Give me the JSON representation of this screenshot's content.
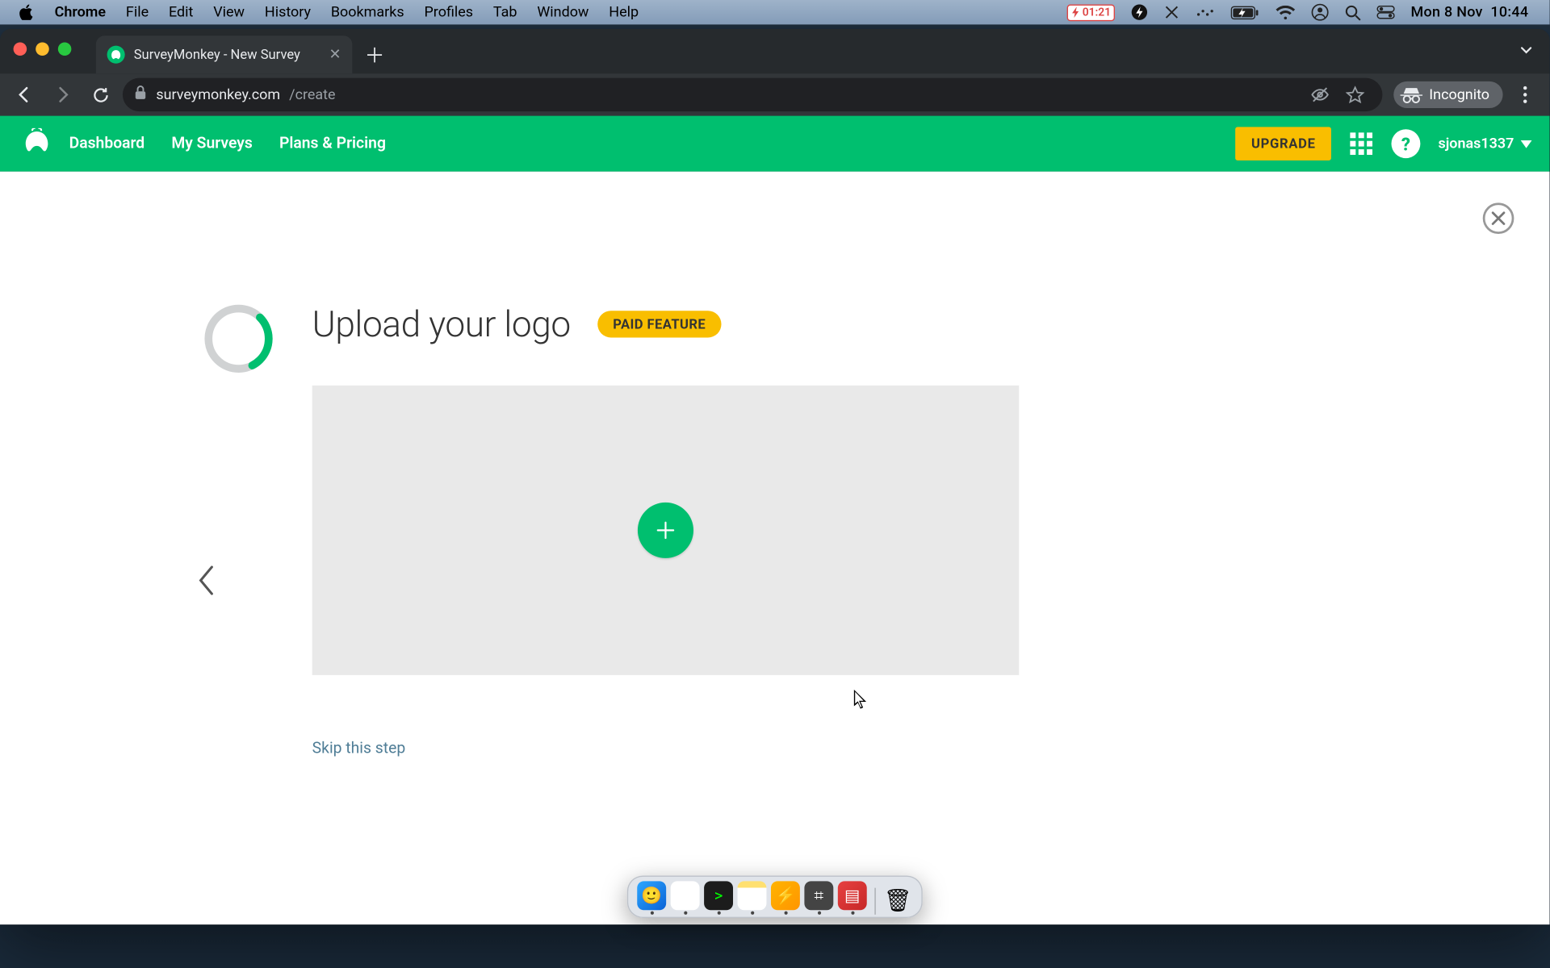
{
  "mac_menu": {
    "app": "Chrome",
    "items": [
      "File",
      "Edit",
      "View",
      "History",
      "Bookmarks",
      "Profiles",
      "Tab",
      "Window",
      "Help"
    ],
    "battery_timer": "01:21",
    "date": "Mon 8 Nov",
    "time": "10:44"
  },
  "browser": {
    "tab_title": "SurveyMonkey - New Survey",
    "url_host": "surveymonkey.com",
    "url_path": "/create",
    "incognito_label": "Incognito"
  },
  "sm_header": {
    "nav": [
      "Dashboard",
      "My Surveys",
      "Plans & Pricing"
    ],
    "upgrade": "UPGRADE",
    "username": "sjonas1337"
  },
  "wizard": {
    "title": "Upload your logo",
    "badge": "PAID FEATURE",
    "skip": "Skip this step",
    "progress_pct": 30
  },
  "dock": {
    "items": [
      {
        "name": "finder",
        "bg": "linear-gradient(135deg,#2da7ff,#0a62d6)",
        "glyph": "🙂"
      },
      {
        "name": "chrome",
        "bg": "#fff",
        "glyph": "◉"
      },
      {
        "name": "terminal",
        "bg": "#1c1c1c",
        "glyph": ">"
      },
      {
        "name": "notes",
        "bg": "linear-gradient(180deg,#ffe070 22%,#fff 22%)",
        "glyph": ""
      },
      {
        "name": "app-y",
        "bg": "linear-gradient(135deg,#ffb400,#ff9500)",
        "glyph": "⚡"
      },
      {
        "name": "screenshot",
        "bg": "#444",
        "glyph": "⌗"
      },
      {
        "name": "msremote",
        "bg": "linear-gradient(135deg,#e74040,#c62828)",
        "glyph": "▤"
      }
    ],
    "trash": {
      "name": "trash",
      "bg": "transparent",
      "glyph": "🗑"
    }
  }
}
